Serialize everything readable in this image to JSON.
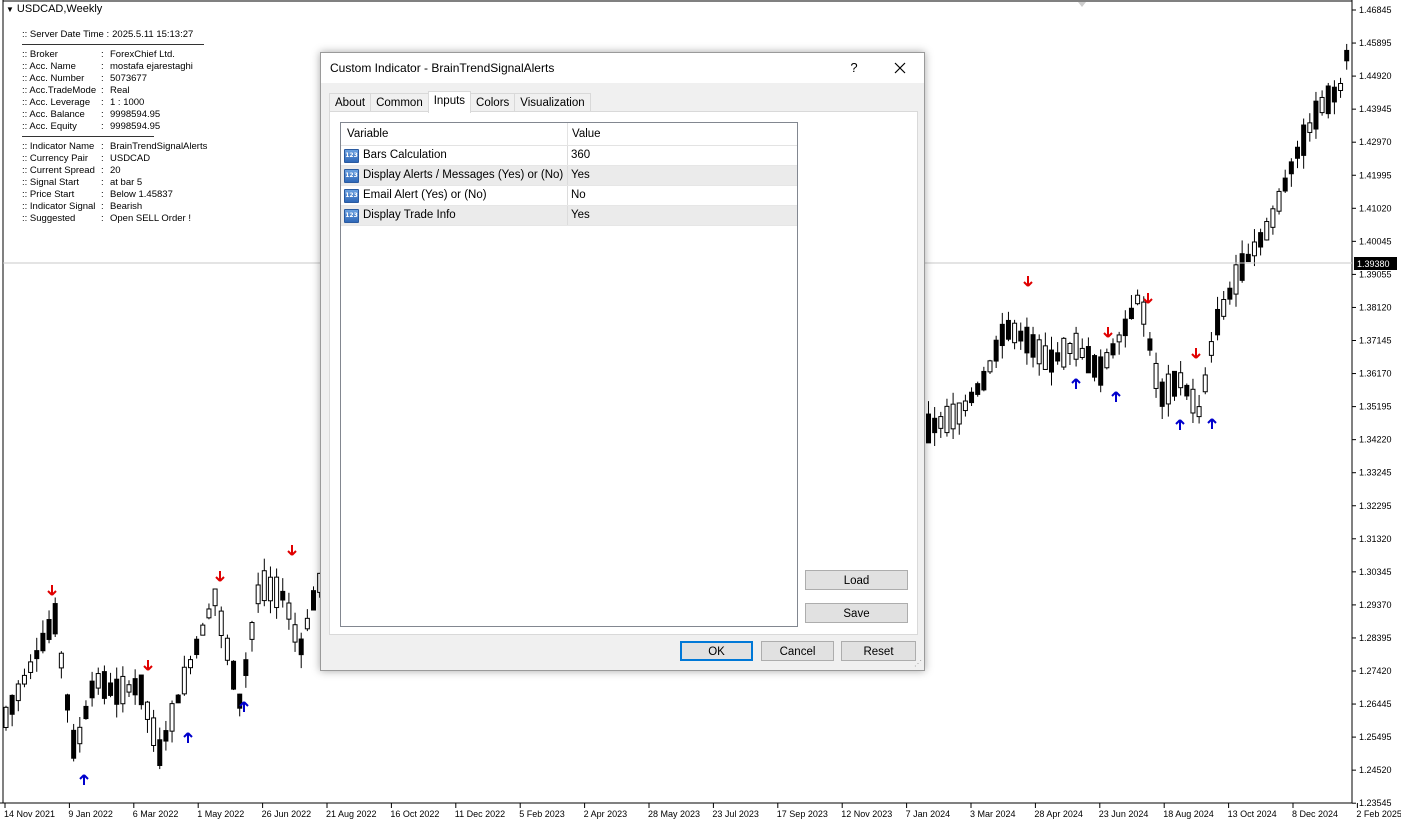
{
  "chart": {
    "title": "USDCAD,Weekly",
    "current_price": "1.39380",
    "price_labels": [
      "1.46845",
      "1.45895",
      "1.44920",
      "1.43945",
      "1.42970",
      "1.41995",
      "1.41020",
      "1.40045",
      "1.39055",
      "1.38120",
      "1.37145",
      "1.36170",
      "1.35195",
      "1.34220",
      "1.33245",
      "1.32295",
      "1.31320",
      "1.30345",
      "1.29370",
      "1.28395",
      "1.27420",
      "1.26445",
      "1.25495",
      "1.24520",
      "1.23545"
    ],
    "date_labels": [
      "14 Nov 2021",
      "9 Jan 2022",
      "6 Mar 2022",
      "1 May 2022",
      "26 Jun 2022",
      "21 Aug 2022",
      "16 Oct 2022",
      "11 Dec 2022",
      "5 Feb 2023",
      "2 Apr 2023",
      "28 May 2023",
      "23 Jul 2023",
      "17 Sep 2023",
      "12 Nov 2023",
      "7 Jan 2024",
      "3 Mar 2024",
      "28 Apr 2024",
      "23 Jun 2024",
      "18 Aug 2024",
      "13 Oct 2024",
      "8 Dec 2024",
      "2 Feb 2025"
    ],
    "colors": {
      "bull": "#ffffff",
      "bear": "#000000",
      "up_arrow": "#0000cc",
      "down_arrow": "#e00000",
      "grid_line": "#c8c8c8"
    }
  },
  "info": {
    "server": {
      "label": ":: Server Date Time :",
      "value": "2025.5.11    15:13:27"
    },
    "account": [
      {
        "label": ":: Broker",
        "value": "ForexChief Ltd."
      },
      {
        "label": ":: Acc. Name",
        "value": "mostafa ejarestaghi"
      },
      {
        "label": ":: Acc. Number",
        "value": "5073677"
      },
      {
        "label": ":: Acc.TradeMode",
        "value": "Real"
      },
      {
        "label": ":: Acc. Leverage",
        "value": "1 : 1000"
      },
      {
        "label": ":: Acc. Balance",
        "value": "9998594.95"
      },
      {
        "label": ":: Acc. Equity",
        "value": "9998594.95"
      }
    ],
    "indicator": [
      {
        "label": ":: Indicator Name",
        "value": "BrainTrendSignalAlerts"
      },
      {
        "label": ":: Currency Pair",
        "value": "USDCAD"
      },
      {
        "label": ":: Current Spread",
        "value": "20"
      },
      {
        "label": ":: Signal Start",
        "value": "at bar 5"
      },
      {
        "label": ":: Price Start",
        "value": "Below 1.45837"
      },
      {
        "label": ":: Indicator Signal",
        "value": "Bearish"
      },
      {
        "label": ":: Suggested",
        "value": "Open SELL Order !"
      }
    ]
  },
  "dialog": {
    "title": "Custom Indicator - BrainTrendSignalAlerts",
    "help": "?",
    "tabs": [
      "About",
      "Common",
      "Inputs",
      "Colors",
      "Visualization"
    ],
    "active_tab": "Inputs",
    "columns": {
      "variable": "Variable",
      "value": "Value"
    },
    "icon_text": "123",
    "rows": [
      {
        "variable": "Bars Calculation",
        "value": "360"
      },
      {
        "variable": "Display Alerts / Messages (Yes) or (No)",
        "value": "Yes"
      },
      {
        "variable": "Email Alert (Yes) or (No)",
        "value": "No"
      },
      {
        "variable": "Display Trade Info",
        "value": "Yes"
      }
    ],
    "buttons": {
      "load": "Load",
      "save": "Save",
      "ok": "OK",
      "cancel": "Cancel",
      "reset": "Reset"
    }
  }
}
